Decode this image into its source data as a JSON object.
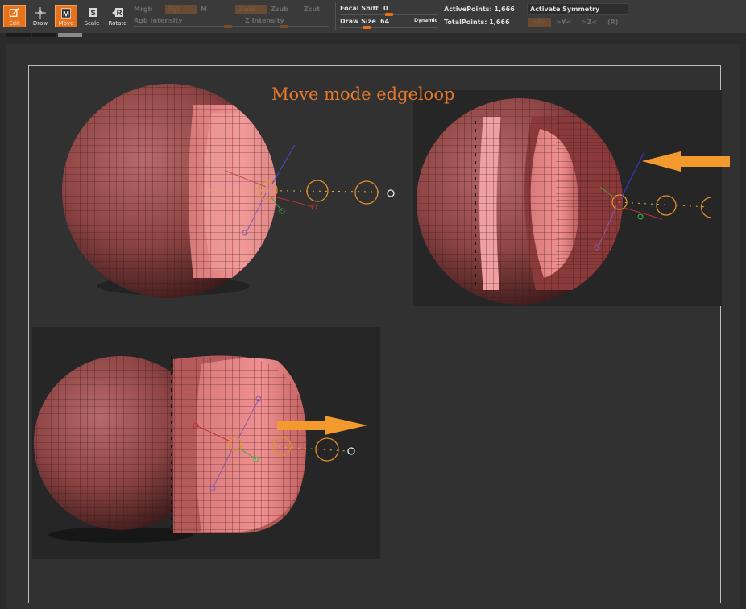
{
  "toolbar": {
    "buttons": [
      {
        "name": "edit",
        "label": "Edit",
        "active": true
      },
      {
        "name": "draw",
        "label": "Draw",
        "active": false
      },
      {
        "name": "move",
        "label": "Move",
        "active": true
      },
      {
        "name": "scale",
        "label": "Scale",
        "active": false
      },
      {
        "name": "rotate",
        "label": "Rotate",
        "active": false
      }
    ],
    "mrgb": "Mrgb",
    "rgb": "Rgb",
    "m": "M",
    "zadd": "Zadd",
    "zsub": "Zsub",
    "zcut": "Zcut",
    "rgb_intensity": "Rgb Intensity",
    "z_intensity": "Z Intensity",
    "focal_shift_label": "Focal Shift",
    "focal_shift_value": "0",
    "draw_size_label": "Draw Size",
    "draw_size_value": "64",
    "dynamic": "Dynamic",
    "active_points": "ActivePoints: 1,666",
    "total_points": "TotalPoints: 1,666",
    "activate_symmetry": "Activate Symmetry",
    "sym_x": ">X<",
    "sym_y": ">Y<",
    "sym_z": ">Z<",
    "sym_r": "(R)",
    "accent": "#e8711c"
  },
  "canvas": {
    "caption": "Move mode edgeloop",
    "caption_color": "#e4782b",
    "arrow_color": "#f29a2e",
    "mesh_color": "#b35a5a"
  }
}
